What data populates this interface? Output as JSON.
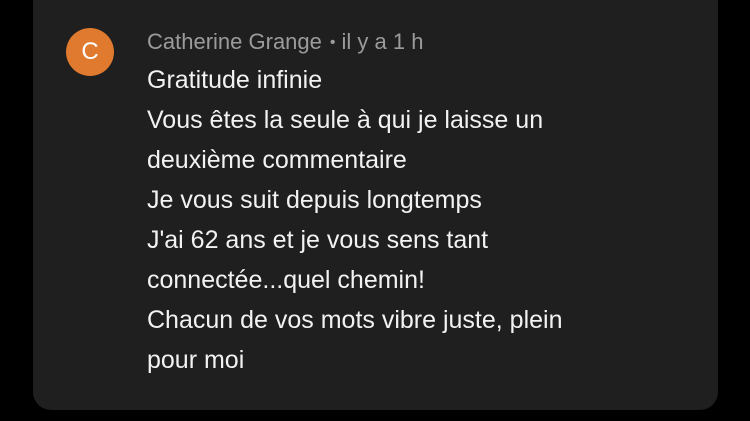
{
  "comment": {
    "author_initial": "C",
    "author_name": "Catherine Grange",
    "separator": "•",
    "timestamp": "il y a 1 h",
    "lines": [
      "Gratitude infinie",
      "Vous êtes la seule à qui je laisse un",
      "deuxième commentaire",
      "Je vous suit depuis longtemps",
      "J'ai 62 ans et je vous sens tant",
      "connectée...quel chemin!",
      "Chacun de vos mots vibre juste, plein",
      "pour moi"
    ]
  },
  "colors": {
    "background": "#000000",
    "card": "#1f1f1f",
    "avatar": "#e07a2e",
    "meta_text": "#9b9b9b",
    "body_text": "#f2f2f2"
  }
}
